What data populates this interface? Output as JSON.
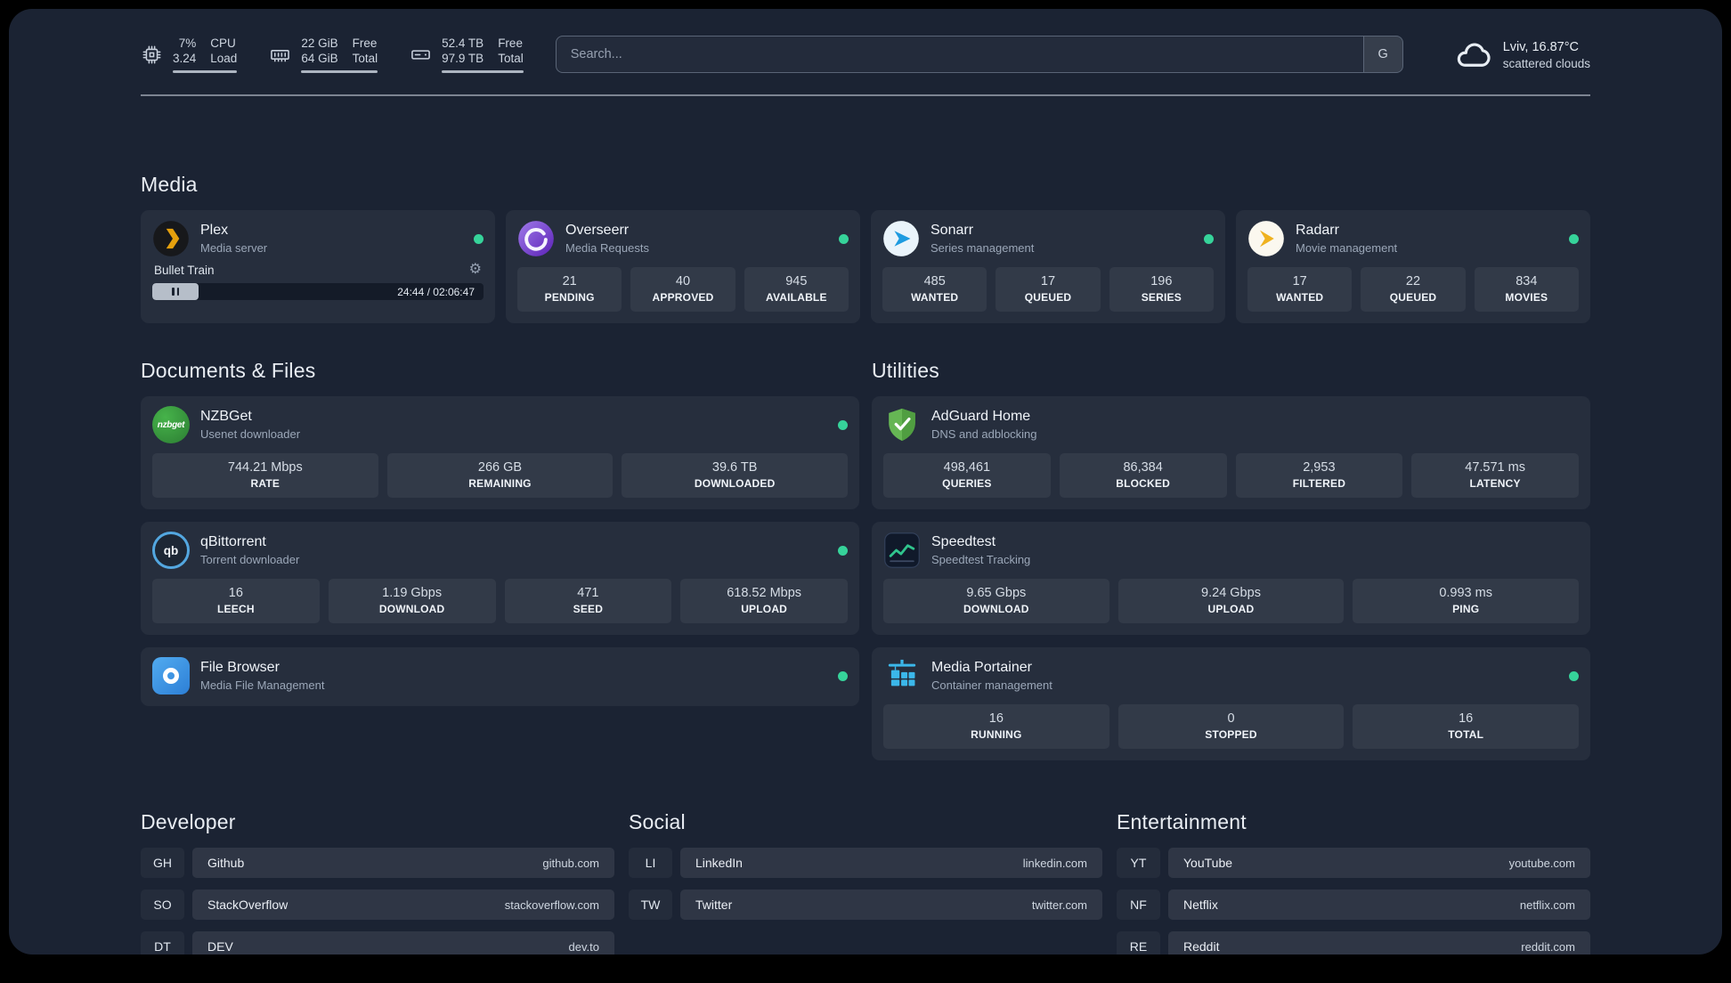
{
  "icons": {
    "gear": "⚙"
  },
  "header": {
    "resources": [
      {
        "values": [
          "7%",
          "3.24"
        ],
        "labels": [
          "CPU",
          "Load"
        ]
      },
      {
        "values": [
          "22 GiB",
          "64 GiB"
        ],
        "labels": [
          "Free",
          "Total"
        ]
      },
      {
        "values": [
          "52.4 TB",
          "97.9 TB"
        ],
        "labels": [
          "Free",
          "Total"
        ]
      }
    ],
    "search": {
      "placeholder": "Search...",
      "provider": "G"
    },
    "weather": {
      "summary": "Lviv, 16.87°C",
      "condition": "scattered clouds"
    }
  },
  "media": {
    "title": "Media",
    "plex": {
      "name": "Plex",
      "desc": "Media server",
      "now_playing": "Bullet Train",
      "time": "24:44 / 02:06:47",
      "progress": "14%"
    },
    "overseerr": {
      "name": "Overseerr",
      "desc": "Media Requests",
      "stats": [
        {
          "v": "21",
          "l": "PENDING"
        },
        {
          "v": "40",
          "l": "APPROVED"
        },
        {
          "v": "945",
          "l": "AVAILABLE"
        }
      ]
    },
    "sonarr": {
      "name": "Sonarr",
      "desc": "Series management",
      "stats": [
        {
          "v": "485",
          "l": "WANTED"
        },
        {
          "v": "17",
          "l": "QUEUED"
        },
        {
          "v": "196",
          "l": "SERIES"
        }
      ]
    },
    "radarr": {
      "name": "Radarr",
      "desc": "Movie management",
      "stats": [
        {
          "v": "17",
          "l": "WANTED"
        },
        {
          "v": "22",
          "l": "QUEUED"
        },
        {
          "v": "834",
          "l": "MOVIES"
        }
      ]
    }
  },
  "documents": {
    "title": "Documents & Files",
    "nzbget": {
      "name": "NZBGet",
      "desc": "Usenet downloader",
      "icon_text": "nzbget",
      "stats": [
        {
          "v": "744.21 Mbps",
          "l": "RATE"
        },
        {
          "v": "266 GB",
          "l": "REMAINING"
        },
        {
          "v": "39.6 TB",
          "l": "DOWNLOADED"
        }
      ]
    },
    "qbittorrent": {
      "name": "qBittorrent",
      "desc": "Torrent downloader",
      "icon_text": "qb",
      "stats": [
        {
          "v": "16",
          "l": "LEECH"
        },
        {
          "v": "1.19 Gbps",
          "l": "DOWNLOAD"
        },
        {
          "v": "471",
          "l": "SEED"
        },
        {
          "v": "618.52 Mbps",
          "l": "UPLOAD"
        }
      ]
    },
    "filebrowser": {
      "name": "File Browser",
      "desc": "Media File Management"
    }
  },
  "utilities": {
    "title": "Utilities",
    "adguard": {
      "name": "AdGuard Home",
      "desc": "DNS and adblocking",
      "stats": [
        {
          "v": "498,461",
          "l": "QUERIES"
        },
        {
          "v": "86,384",
          "l": "BLOCKED"
        },
        {
          "v": "2,953",
          "l": "FILTERED"
        },
        {
          "v": "47.571 ms",
          "l": "LATENCY"
        }
      ]
    },
    "speedtest": {
      "name": "Speedtest",
      "desc": "Speedtest Tracking",
      "stats": [
        {
          "v": "9.65 Gbps",
          "l": "DOWNLOAD"
        },
        {
          "v": "9.24 Gbps",
          "l": "UPLOAD"
        },
        {
          "v": "0.993 ms",
          "l": "PING"
        }
      ]
    },
    "portainer": {
      "name": "Media Portainer",
      "desc": "Container management",
      "stats": [
        {
          "v": "16",
          "l": "RUNNING"
        },
        {
          "v": "0",
          "l": "STOPPED"
        },
        {
          "v": "16",
          "l": "TOTAL"
        }
      ]
    }
  },
  "bookmarks": [
    {
      "title": "Developer",
      "items": [
        {
          "abbr": "GH",
          "name": "Github",
          "url": "github.com"
        },
        {
          "abbr": "SO",
          "name": "StackOverflow",
          "url": "stackoverflow.com"
        },
        {
          "abbr": "DT",
          "name": "DEV",
          "url": "dev.to"
        }
      ]
    },
    {
      "title": "Social",
      "items": [
        {
          "abbr": "LI",
          "name": "LinkedIn",
          "url": "linkedin.com"
        },
        {
          "abbr": "TW",
          "name": "Twitter",
          "url": "twitter.com"
        }
      ]
    },
    {
      "title": "Entertainment",
      "items": [
        {
          "abbr": "YT",
          "name": "YouTube",
          "url": "youtube.com"
        },
        {
          "abbr": "NF",
          "name": "Netflix",
          "url": "netflix.com"
        },
        {
          "abbr": "RE",
          "name": "Reddit",
          "url": "reddit.com"
        }
      ]
    }
  ],
  "colors": {
    "status_online": "#36d39a"
  }
}
